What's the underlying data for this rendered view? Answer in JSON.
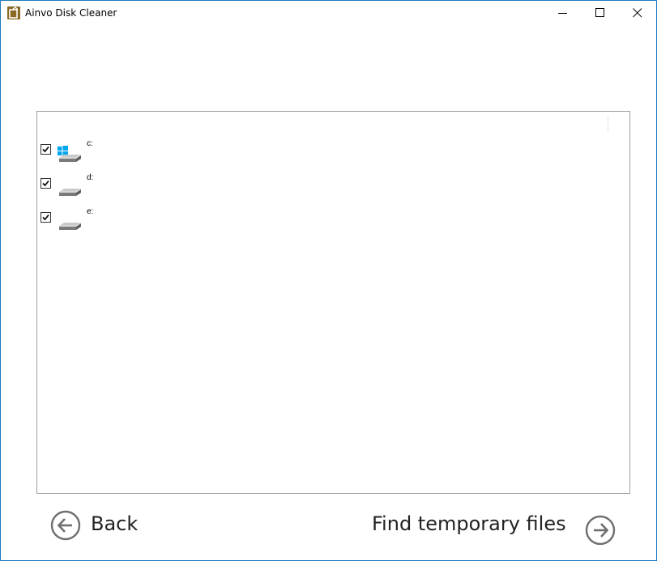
{
  "window": {
    "title": "Ainvo Disk Cleaner",
    "controls": {
      "minimize": "minimize-icon",
      "maximize": "maximize-icon",
      "close": "close-icon"
    }
  },
  "drives": [
    {
      "label": "c:",
      "checked": true,
      "icon": "system-drive-icon"
    },
    {
      "label": "d:",
      "checked": true,
      "icon": "drive-icon"
    },
    {
      "label": "e:",
      "checked": true,
      "icon": "drive-icon"
    }
  ],
  "nav": {
    "back_label": "Back",
    "back_icon": "arrow-left-circle-icon",
    "next_label": "Find temporary files",
    "next_icon": "arrow-right-circle-icon"
  },
  "colors": {
    "window_border": "#1e7ab8",
    "windows_logo": "#00a4ef",
    "app_icon": "#8a6a24",
    "panel_border": "#a0a0a0"
  }
}
